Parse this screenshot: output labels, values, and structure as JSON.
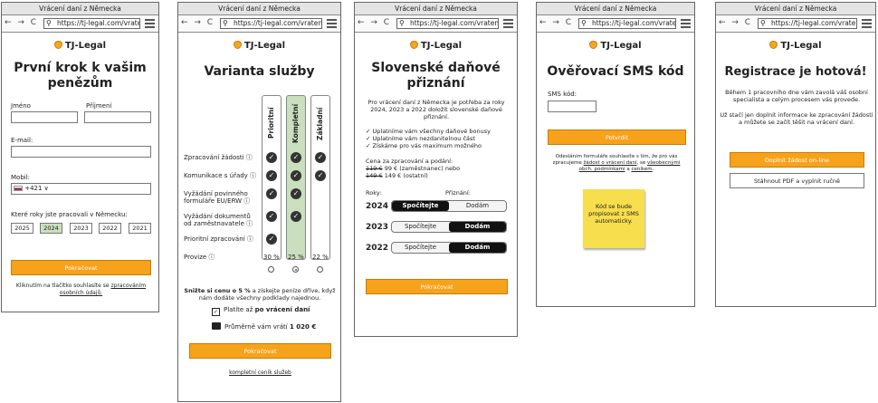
{
  "common": {
    "window_title": "Vrácení daní z Německa",
    "nav": "← → C",
    "url": "https://tj-legal.com/vrateni",
    "brand": "TJ-Legal"
  },
  "screen1": {
    "title_l1": "První krok k vašim",
    "title_l2": "penězům",
    "first_name_label": "Jméno",
    "last_name_label": "Příjmení",
    "email_label": "E-mail:",
    "mobile_label": "Mobil:",
    "phone_prefix": "+421 ∨",
    "years_label": "Které roky jste pracovali v Německu:",
    "years": [
      "2025",
      "2024",
      "2023",
      "2022",
      "2021"
    ],
    "selected_year": "2024",
    "continue": "Pokračovat",
    "consent_l1": "Kliknutím na tlačítko souhlasíte se",
    "consent_link1": "zpracováním",
    "consent_link2": "osobních údajů."
  },
  "screen2": {
    "title": "Varianta služby",
    "columns": [
      "Prioritní",
      "Kompletní",
      "Základní"
    ],
    "rows": [
      {
        "label": "Zpracování žádosti ⓘ",
        "checks": [
          true,
          true,
          true
        ]
      },
      {
        "label": "Komunikace s úřady ⓘ",
        "checks": [
          true,
          true,
          true
        ]
      },
      {
        "label": "Vyžádání povinného formuláře EU/ERW ⓘ",
        "checks": [
          true,
          true,
          false
        ]
      },
      {
        "label": "Vyžádání dokumentů od zaměstnavatele ⓘ",
        "checks": [
          true,
          true,
          false
        ]
      },
      {
        "label": "Prioritní zpracování ⓘ",
        "checks": [
          true,
          false,
          false
        ]
      }
    ],
    "fee_label": "Provize ⓘ",
    "fees": [
      "30 %",
      "25 %",
      "22 %"
    ],
    "selected_column": "Kompletní",
    "promo_bold_a": "Snižte si cenu o 5 %",
    "promo_rest": "a získejte peníze dříve, když nám dodáte všechny podklady najednou.",
    "pay_prefix": "Platíte až",
    "pay_bold": "po vrácení daní",
    "avg_prefix": "Průměrně vám vrátí",
    "avg_bold": "1 020 €",
    "continue": "Pokračovat",
    "pricelist_link": "kompletní ceník služeb"
  },
  "screen3": {
    "title_l1": "Slovenské daňové",
    "title_l2": "přiznání",
    "intro": "Pro vrácení daní z Německa je potřeba za roky 2024, 2023 a 2022 doložit slovenské daňové přiznání.",
    "bullets": [
      "✓ Uplatníme vám všechny daňové bonusy",
      "✓ Uplatníme vám nezdanitelnou část",
      "✓ Získáme pro vás maximum možného"
    ],
    "price_label": "Cena za zpracování a podání:",
    "price_a_old": "119 €",
    "price_a_new": "99 € (zaměstnanec) nebo",
    "price_b_old": "149 €",
    "price_b_new": "149 € (ostatní)",
    "years_header": "Roky:",
    "filing_header": "Přiznání:",
    "rows": [
      {
        "year": "2024",
        "left": "Spočítejte",
        "right": "Dodám",
        "active": "left"
      },
      {
        "year": "2023",
        "left": "Spočítejte",
        "right": "Dodám",
        "active": "right"
      },
      {
        "year": "2022",
        "left": "Spočítejte",
        "right": "Dodám",
        "active": "right"
      }
    ],
    "continue": "Pokračovat"
  },
  "screen4": {
    "title": "Ověřovací SMS kód",
    "sms_label": "SMS kód:",
    "confirm": "Potvrdit",
    "legal_l1": "Odesláním formuláře souhlasíte s tím, že pro vás",
    "legal_l2a": "zpracujeme",
    "legal_link1": "žádost o vrácení daní",
    "legal_l2b": ", se",
    "legal_link2": "všeobecnými",
    "legal_link3": "obch. podmínkami",
    "legal_l3b": "a",
    "legal_link4": "ceníkem",
    "sticky_note": "Kód se bude propisovat z SMS automaticky."
  },
  "screen5": {
    "title": "Registrace je hotová!",
    "para1": "Během 1 pracovního dne vám zavolá váš osobní specialista a celým procesem vás provede.",
    "para2": "Už stačí jen doplnit informace ke zpracování žádosti a můžete se začít těšit na vrácení daní.",
    "primary": "Doplnit žádost on-line",
    "secondary": "Stáhnout PDF a vyplnit ručně"
  },
  "colors": {
    "accent": "#f7a21b",
    "selected_green": "#c9dfbd"
  }
}
